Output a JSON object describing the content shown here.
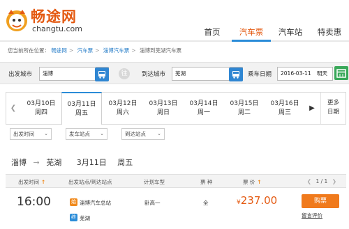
{
  "header": {
    "logo_cn": "畅途网",
    "logo_en": "changtu.com",
    "nav": [
      "首页",
      "汽车票",
      "汽车站",
      "特卖惠"
    ],
    "active_nav": 1
  },
  "breadcrumb": {
    "prefix": "您当前所在位置：",
    "links": [
      "畅途网",
      "汽车票",
      "淄博汽车票"
    ],
    "current": "淄博到芜湖汽车票"
  },
  "search": {
    "from_label": "出发城市",
    "from_value": "淄博",
    "to_label": "到达城市",
    "to_value": "芜湖",
    "date_label": "乘车日期",
    "date_value": "2016-03-11",
    "date_weekday": "明天",
    "swap_icon": "往"
  },
  "dates": [
    {
      "date": "03月10日",
      "weekday": "周四"
    },
    {
      "date": "03月11日",
      "weekday": "周五"
    },
    {
      "date": "03月12日",
      "weekday": "周六"
    },
    {
      "date": "03月13日",
      "weekday": "周日"
    },
    {
      "date": "03月14日",
      "weekday": "周一"
    },
    {
      "date": "03月15日",
      "weekday": "周二"
    },
    {
      "date": "03月16日",
      "weekday": "周三"
    }
  ],
  "active_date": 1,
  "more_dates": [
    "更多",
    "日期"
  ],
  "filters": [
    "出发时间",
    "发车站点",
    "到达站点"
  ],
  "route": {
    "from": "淄博",
    "arrow": "→",
    "to": "芜湖",
    "date": "3月11日",
    "weekday": "周五"
  },
  "table": {
    "headers": [
      "出发时间",
      "出发站点/到达站点",
      "计划车型",
      "票  种",
      "票  价"
    ],
    "pager": "1 / 1"
  },
  "trips": [
    {
      "time": "16:00",
      "depart_badge": "始",
      "depart_station": "淄博汽车总站",
      "arrive_badge": "终",
      "arrive_station": "芜湖",
      "vehicle": "卧高一",
      "ticket_type": "全",
      "currency": "¥",
      "price": "237.00",
      "buy_label": "购票",
      "review_label": "留言评价"
    }
  ],
  "colors": {
    "brand_orange": "#e45a12",
    "accent_blue": "#2a8cd8",
    "buy_button": "#f07a1c",
    "calendar_green": "#3aa85a"
  }
}
